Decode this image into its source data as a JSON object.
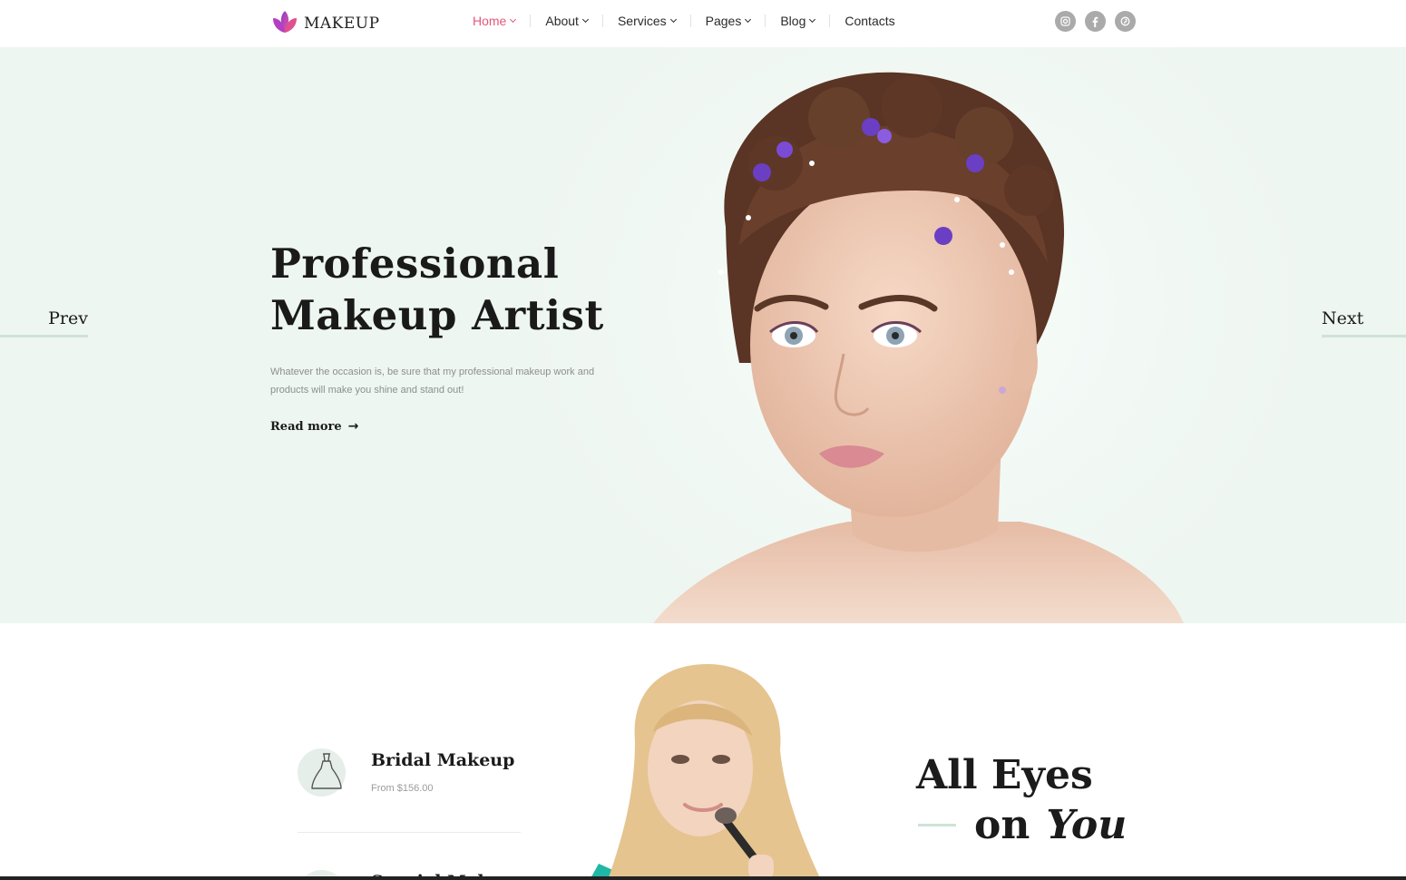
{
  "brand": {
    "name": "MAKEUP",
    "logo_icon": "lotus-icon",
    "logo_color": "#c63fa5"
  },
  "nav": {
    "items": [
      {
        "label": "Home",
        "active": true,
        "has_dropdown": true
      },
      {
        "label": "About",
        "active": false,
        "has_dropdown": true
      },
      {
        "label": "Services",
        "active": false,
        "has_dropdown": true
      },
      {
        "label": "Pages",
        "active": false,
        "has_dropdown": true
      },
      {
        "label": "Blog",
        "active": false,
        "has_dropdown": true
      },
      {
        "label": "Contacts",
        "active": false,
        "has_dropdown": false
      }
    ],
    "active_color": "#e5587d"
  },
  "social": [
    {
      "icon": "instagram-icon"
    },
    {
      "icon": "facebook-icon"
    },
    {
      "icon": "pinterest-icon"
    }
  ],
  "hero": {
    "title_line1": "Professional",
    "title_line2": "Makeup Artist",
    "description": "Whatever the occasion is, be sure that my professional makeup work and products will make you shine and stand out!",
    "read_more": "Read more",
    "prev_label": "Prev",
    "next_label": "Next",
    "background_color": "#eef6f1"
  },
  "services": {
    "items": [
      {
        "title": "Bridal Makeup",
        "price": "From $156.00",
        "icon": "dress-icon"
      },
      {
        "title": "Special Makeup",
        "price": "",
        "icon": "brush-icon"
      }
    ]
  },
  "feature": {
    "title_line1": "All Eyes",
    "title_on": "on",
    "title_you": "You"
  },
  "accent_line_color": "#cfe3d6"
}
